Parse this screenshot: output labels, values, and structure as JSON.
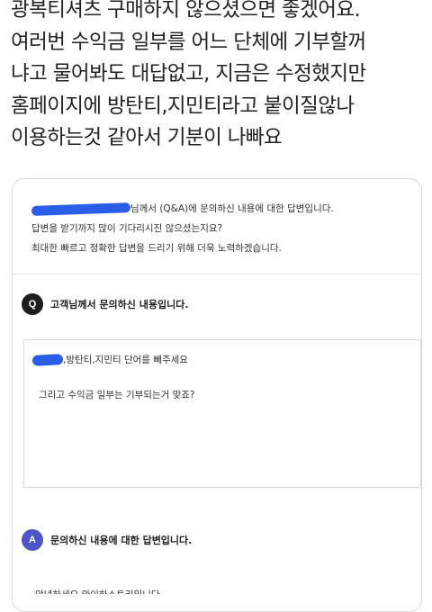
{
  "post": {
    "lines": [
      "광복티셔츠 구매하지 않으셨으면 좋겠어요.",
      "여러번 수익금 일부를 어느 단체에 기부할꺼",
      "냐고 물어봐도 대답없고, 지금은 수정했지만",
      "홈페이지에 방탄티,지민티라고 붙이질않나",
      "이용하는것 같아서 기분이 나빠요"
    ]
  },
  "card": {
    "intro_line1": "님께서 (Q&A)에 문의하신 내용에 대한 답변입니다.",
    "intro_line2": "답변을 받기까지 많이 기다리시진 않으셨는지요?",
    "intro_line3": "최대한 빠르고 정확한 답변을 드리기 위해 더욱 노력하겠습니다.",
    "question_badge": "Q",
    "question_heading": "고객님께서 문의하신 내용입니다.",
    "question_line1": ",방탄티,지민티 단어를 빼주세요",
    "question_line2": "그리고 수익금 일부는 기부되는거 맞죠?",
    "answer_badge": "A",
    "answer_heading": "문의하신 내용에 대한 답변입니다.",
    "answer_preview": "안녕하세요 와이하스토리입니다"
  },
  "colors": {
    "redaction": "#2b5ee8",
    "question_badge": "#1e1e1e",
    "answer_badge": "#4d55c8"
  }
}
